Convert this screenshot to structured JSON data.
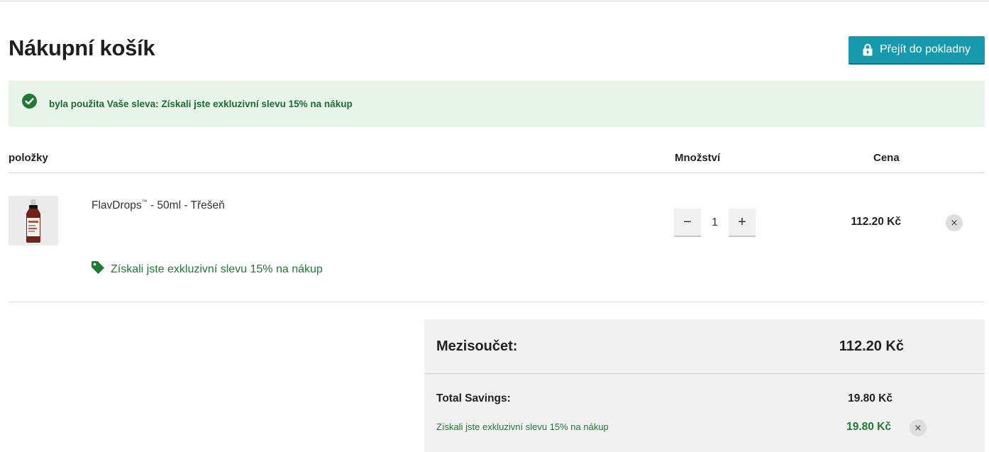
{
  "page": {
    "title": "Nákupní košík",
    "checkout_button": "Přejít do pokladny"
  },
  "notice": {
    "message": "byla použita Vaše sleva: Získali jste exkluzivní slevu 15% na nákup",
    "status_color": "#1e6b2e"
  },
  "table": {
    "headers": {
      "items": "položky",
      "quantity": "Množství",
      "price": "Cena"
    }
  },
  "cart_items": [
    {
      "name": "FlavDrops",
      "trademark": "™",
      "variant": " - 50ml - Třešeň",
      "quantity": "1",
      "minus_symbol": "−",
      "plus_symbol": "+",
      "price": "112.20 Kč",
      "remove_symbol": "×",
      "discount": "Získali jste exkluzivní slevu 15% na nákup"
    }
  ],
  "summary": {
    "subtotal_label": "Mezisoučet:",
    "subtotal_value": "112.20 Kč",
    "savings_label": "Total Savings:",
    "savings_value": "19.80 Kč",
    "discount_label": "Získali jste exkluzivní slevu 15% na nákup",
    "discount_value": "19.80 Kč",
    "remove_symbol": "×"
  },
  "colors": {
    "accent": "#1799ad",
    "success": "#1e7a35",
    "notice_bg": "#e8f4ea"
  },
  "icons": [
    "lock-icon",
    "check-circle-icon",
    "tag-icon",
    "close-icon",
    "product-bottle-image"
  ]
}
